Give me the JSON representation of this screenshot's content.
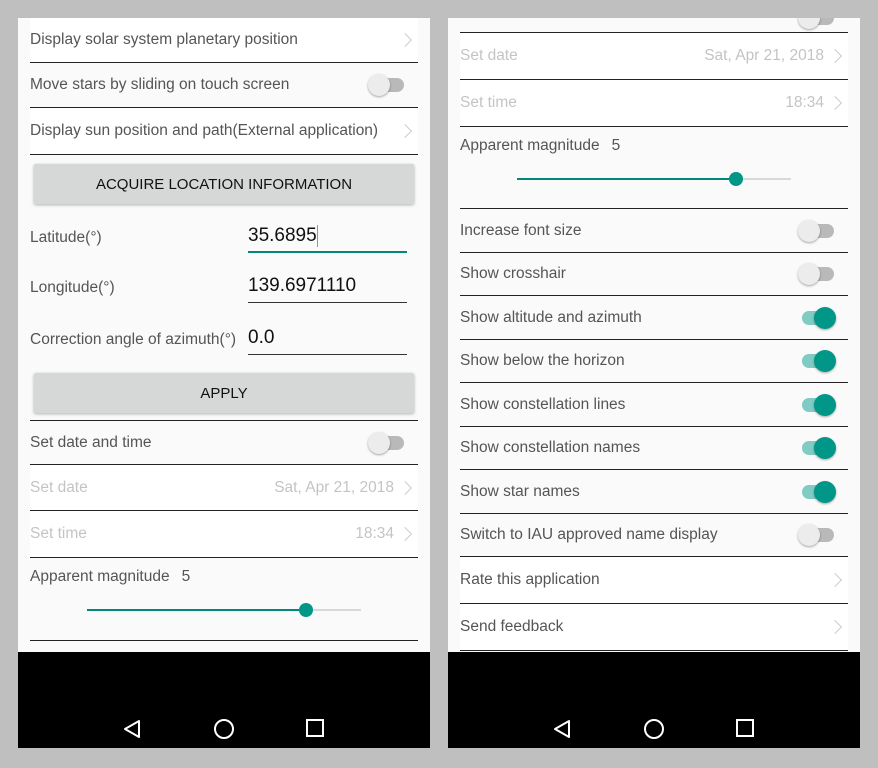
{
  "accent_color": "#009688",
  "left_panel": {
    "items": [
      {
        "type": "link",
        "label": "Display solar system planetary position"
      },
      {
        "type": "toggle",
        "label": "Move stars by sliding on touch screen",
        "on": false
      },
      {
        "type": "link",
        "label": "Display sun position and path(External application)"
      },
      {
        "type": "button",
        "label": "ACQUIRE LOCATION INFORMATION"
      },
      {
        "type": "field",
        "label": "Latitude(°)",
        "value": "35.6895",
        "focused": true
      },
      {
        "type": "field",
        "label": "Longitude(°)",
        "value": "139.6971110",
        "focused": false
      },
      {
        "type": "field",
        "label": "Correction angle of azimuth(°)",
        "value": "0.0",
        "focused": false
      },
      {
        "type": "button",
        "label": "APPLY"
      },
      {
        "type": "toggle",
        "label": "Set date and time",
        "on": false
      },
      {
        "type": "link",
        "label": "Set date",
        "value": "Sat, Apr 21, 2018",
        "disabled": true
      },
      {
        "type": "link",
        "label": "Set time",
        "value": "18:34",
        "disabled": true
      },
      {
        "type": "slider",
        "label": "Apparent magnitude",
        "value": "5",
        "fraction": 0.8
      }
    ]
  },
  "right_panel": {
    "items": [
      {
        "type": "partial-toggle",
        "on": false
      },
      {
        "type": "link",
        "label": "Set date",
        "value": "Sat, Apr 21, 2018",
        "disabled": true
      },
      {
        "type": "link",
        "label": "Set time",
        "value": "18:34",
        "disabled": true
      },
      {
        "type": "slider",
        "label": "Apparent magnitude",
        "value": "5",
        "fraction": 0.8
      },
      {
        "type": "toggle",
        "label": "Increase font size",
        "on": false
      },
      {
        "type": "toggle",
        "label": "Show crosshair",
        "on": false
      },
      {
        "type": "toggle",
        "label": "Show altitude and azimuth",
        "on": true
      },
      {
        "type": "toggle",
        "label": "Show below the horizon",
        "on": true
      },
      {
        "type": "toggle",
        "label": "Show constellation lines",
        "on": true
      },
      {
        "type": "toggle",
        "label": "Show constellation names",
        "on": true
      },
      {
        "type": "toggle",
        "label": "Show star names",
        "on": true
      },
      {
        "type": "toggle",
        "label": "Switch to IAU approved name display",
        "on": false
      },
      {
        "type": "link",
        "label": "Rate this application"
      },
      {
        "type": "link",
        "label": "Send feedback"
      }
    ]
  },
  "nav_bar": {
    "buttons": [
      "back-icon",
      "home-icon",
      "recents-icon"
    ]
  }
}
